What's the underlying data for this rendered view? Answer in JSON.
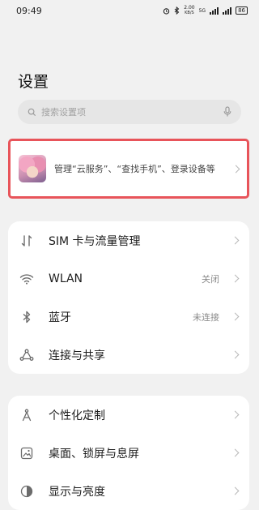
{
  "status_bar": {
    "time": "09:49",
    "net_speed_value": "2.00",
    "net_speed_unit": "KB/S",
    "battery": "86"
  },
  "page": {
    "title": "设置"
  },
  "search": {
    "placeholder": "搜索设置项",
    "value": ""
  },
  "account": {
    "description": "管理“云服务”、“查找手机”、登录设备等"
  },
  "groups": [
    {
      "items": [
        {
          "label": "SIM 卡与流量管理",
          "value": "",
          "icon": "sim-data-icon"
        },
        {
          "label": "WLAN",
          "value": "关闭",
          "icon": "wifi-icon"
        },
        {
          "label": "蓝牙",
          "value": "未连接",
          "icon": "bluetooth-icon"
        },
        {
          "label": "连接与共享",
          "value": "",
          "icon": "connection-sharing-icon"
        }
      ]
    },
    {
      "items": [
        {
          "label": "个性化定制",
          "value": "",
          "icon": "personalization-icon"
        },
        {
          "label": "桌面、锁屏与息屏",
          "value": "",
          "icon": "wallpaper-icon"
        },
        {
          "label": "显示与亮度",
          "value": "",
          "icon": "brightness-icon"
        }
      ]
    }
  ],
  "colors": {
    "highlight_border": "#e8545a",
    "background": "#f1f1f1"
  }
}
